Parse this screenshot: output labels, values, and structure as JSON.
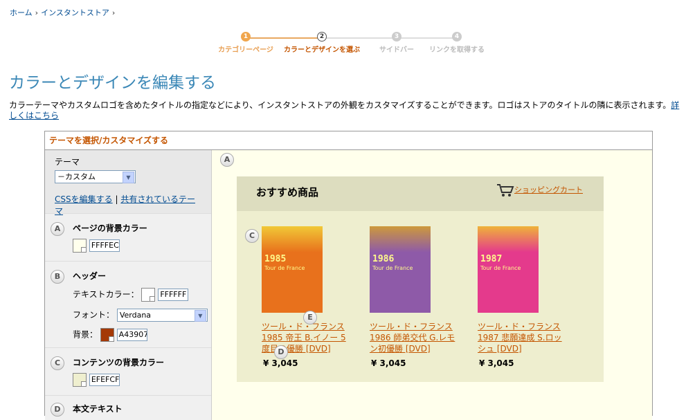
{
  "breadcrumb": [
    "ホーム",
    "インスタントストア"
  ],
  "steps": [
    {
      "num": "1",
      "label": "カテゴリーページ",
      "state": "done"
    },
    {
      "num": "2",
      "label": "カラーとデザインを選ぶ",
      "state": "current"
    },
    {
      "num": "3",
      "label": "サイドバー",
      "state": "todo"
    },
    {
      "num": "4",
      "label": "リンクを取得する",
      "state": "todo"
    }
  ],
  "page_title": "カラーとデザインを編集する",
  "description": "カラーテーマやカスタムロゴを含めたタイトルの指定などにより、インスタントストアの外観をカスタマイズすることができます。ロゴはストアのタイトルの隣に表示されます。",
  "description_link": "詳しくはこちら",
  "panel": {
    "header": "テーマを選択/カスタマイズする",
    "theme_label": "テーマ",
    "theme_value": "－カスタム",
    "edit_css": "CSSを編集する",
    "shared_themes": "共有されているテーマ",
    "link_sep": "|",
    "sections": {
      "page_bg": {
        "badge": "A",
        "label": "ページの背景カラー",
        "color": "#ffffec",
        "hex": "FFFFEC"
      },
      "header": {
        "badge": "B",
        "label": "ヘッダー",
        "text_color_label": "テキストカラー：",
        "text_color": "#ffffff",
        "text_hex": "FFFFFF",
        "font_label": "フォント：",
        "font_value": "Verdana",
        "bg_label": "背景：",
        "bg_color": "#a43907",
        "bg_hex": "A43907"
      },
      "content_bg": {
        "badge": "C",
        "label": "コンテンツの背景カラー",
        "color": "#efefcf",
        "hex": "EFEFCF"
      },
      "body_text": {
        "badge": "D",
        "label": "本文テキスト"
      }
    }
  },
  "preview": {
    "badge_a": "A",
    "badge_c": "C",
    "badge_d": "D",
    "badge_e": "E",
    "title": "おすすめ商品",
    "cart": "ショッピングカート",
    "products": [
      {
        "year": "1985",
        "cover_text": "Tour de France",
        "title": "ツール・ド・フランス 1985 帝王 B.イノー 5度目の優勝 [DVD]",
        "price": "¥ 3,045",
        "color": "#e8711c"
      },
      {
        "year": "1986",
        "cover_text": "Tour de France",
        "title": "ツール・ド・フランス 1986 師弟交代 G.レモン初優勝 [DVD]",
        "price": "¥ 3,045",
        "color": "#8e5aa8"
      },
      {
        "year": "1987",
        "cover_text": "Tour de France",
        "title": "ツール・ド・フランス 1987 悲願達成 S.ロッシュ [DVD]",
        "price": "¥ 3,045",
        "color": "#e43a8c"
      }
    ]
  }
}
